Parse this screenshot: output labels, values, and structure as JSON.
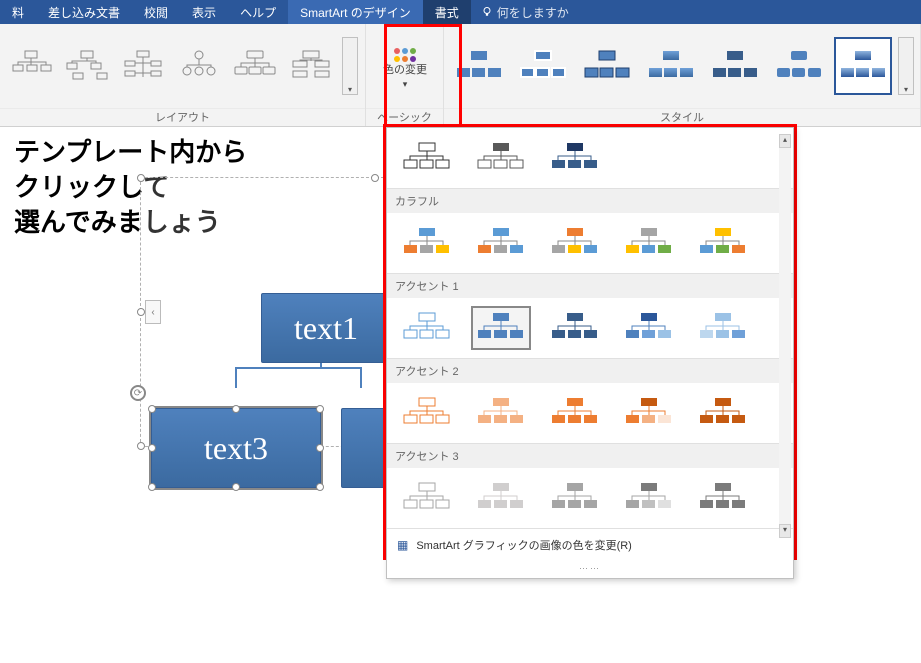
{
  "tabs": {
    "t0": "料",
    "t1": "差し込み文書",
    "t2": "校閲",
    "t3": "表示",
    "t4": "ヘルプ",
    "t5": "SmartArt のデザイン",
    "t6": "書式",
    "search": "何をしますか"
  },
  "ribbon": {
    "layout_label": "レイアウト",
    "color_change_label": "色の変更",
    "basic_label": "ベーシック",
    "style_label": "スタイル"
  },
  "overlay": {
    "line1": "テンプレート内から",
    "line2": "クリックして",
    "line3": "選んでみましょう"
  },
  "nodes": {
    "text1": "text1",
    "text3": "text3"
  },
  "dropdown": {
    "sec_colorful": "カラフル",
    "sec_accent1": "アクセント 1",
    "sec_accent2": "アクセント 2",
    "sec_accent3": "アクセント 3",
    "footer": "SmartArt グラフィックの画像の色を変更(R)"
  },
  "colors": {
    "accent_blue": "#4f81bd",
    "dark_blue": "#385d8a",
    "orange": "#ed7d31",
    "gray": "#a5a5a5",
    "yellow": "#ffc000",
    "light_blue": "#5b9bd5",
    "green": "#70ad47"
  }
}
